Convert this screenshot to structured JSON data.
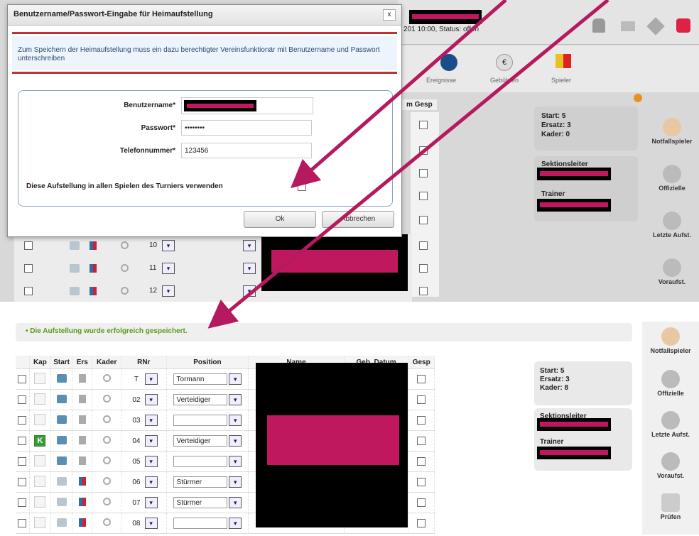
{
  "top": {
    "header_status": "201  10:00, Status: offen",
    "toolbar": [
      "Ereignisse",
      "Gebühren",
      "Spieler"
    ],
    "dialog": {
      "title": "Benutzername/Passwort-Eingabe für Heimaufstellung",
      "close": "x",
      "info": "Zum Speichern der Heimaufstellung muss ein dazu berechtigter Vereinsfunktionär mit Benutzername und Passwort unterschreiben",
      "username_label": "Benutzername*",
      "password_label": "Passwort*",
      "password_value": "••••••••",
      "phone_label": "Telefonnummer*",
      "phone_value": "123456",
      "all_games_label": "Diese Aufstellung in allen Spielen des Turniers verwenden",
      "ok": "Ok",
      "cancel": "Abbrechen"
    },
    "col_header_partial": "m  Gesp",
    "rows": [
      {
        "rnr": "10"
      },
      {
        "rnr": "11"
      },
      {
        "rnr": "12"
      }
    ],
    "summary": {
      "start": "Start: 5",
      "ersatz": "Ersatz: 3",
      "kader": "Kader: 0"
    },
    "roles": {
      "sektionsleiter": "Sektionsleiter",
      "trainer": "Trainer"
    },
    "sidebar": [
      "Notfallspieler",
      "Offizielle",
      "Letzte Aufst.",
      "Voraufst."
    ]
  },
  "bottom": {
    "success_message": "• Die Aufstellung wurde erfolgreich gespeichert.",
    "headers": [
      "",
      "Kap",
      "Start",
      "Ers",
      "Kader",
      "RNr",
      "Position",
      "Name",
      "Geb. Datum",
      "Gesp"
    ],
    "rows": [
      {
        "kap": "",
        "rnr": "T",
        "position": "Tormann",
        "start": true
      },
      {
        "kap": "",
        "rnr": "02",
        "position": "Verteidiger",
        "start": true
      },
      {
        "kap": "",
        "rnr": "03",
        "position": "",
        "start": true
      },
      {
        "kap": "K",
        "rnr": "04",
        "position": "Verteidiger",
        "start": true
      },
      {
        "kap": "",
        "rnr": "05",
        "position": "",
        "start": true
      },
      {
        "kap": "",
        "rnr": "06",
        "position": "Stürmer",
        "start": false
      },
      {
        "kap": "",
        "rnr": "07",
        "position": "Stürmer",
        "start": false
      },
      {
        "kap": "",
        "rnr": "08",
        "position": "",
        "start": false
      }
    ],
    "summary": {
      "start": "Start: 5",
      "ersatz": "Ersatz: 3",
      "kader": "Kader: 8"
    },
    "roles": {
      "sektionsleiter": "Sektionsleiter",
      "trainer": "Trainer"
    },
    "sidebar": [
      "Notfallspieler",
      "Offizielle",
      "Letzte Aufst.",
      "Voraufst.",
      "Prüfen"
    ]
  },
  "colors": {
    "annotation_arrow": "#b5195e",
    "redact_pink": "#c0185e",
    "success_green": "#5a9a1a",
    "dialog_accent": "#c23030"
  }
}
